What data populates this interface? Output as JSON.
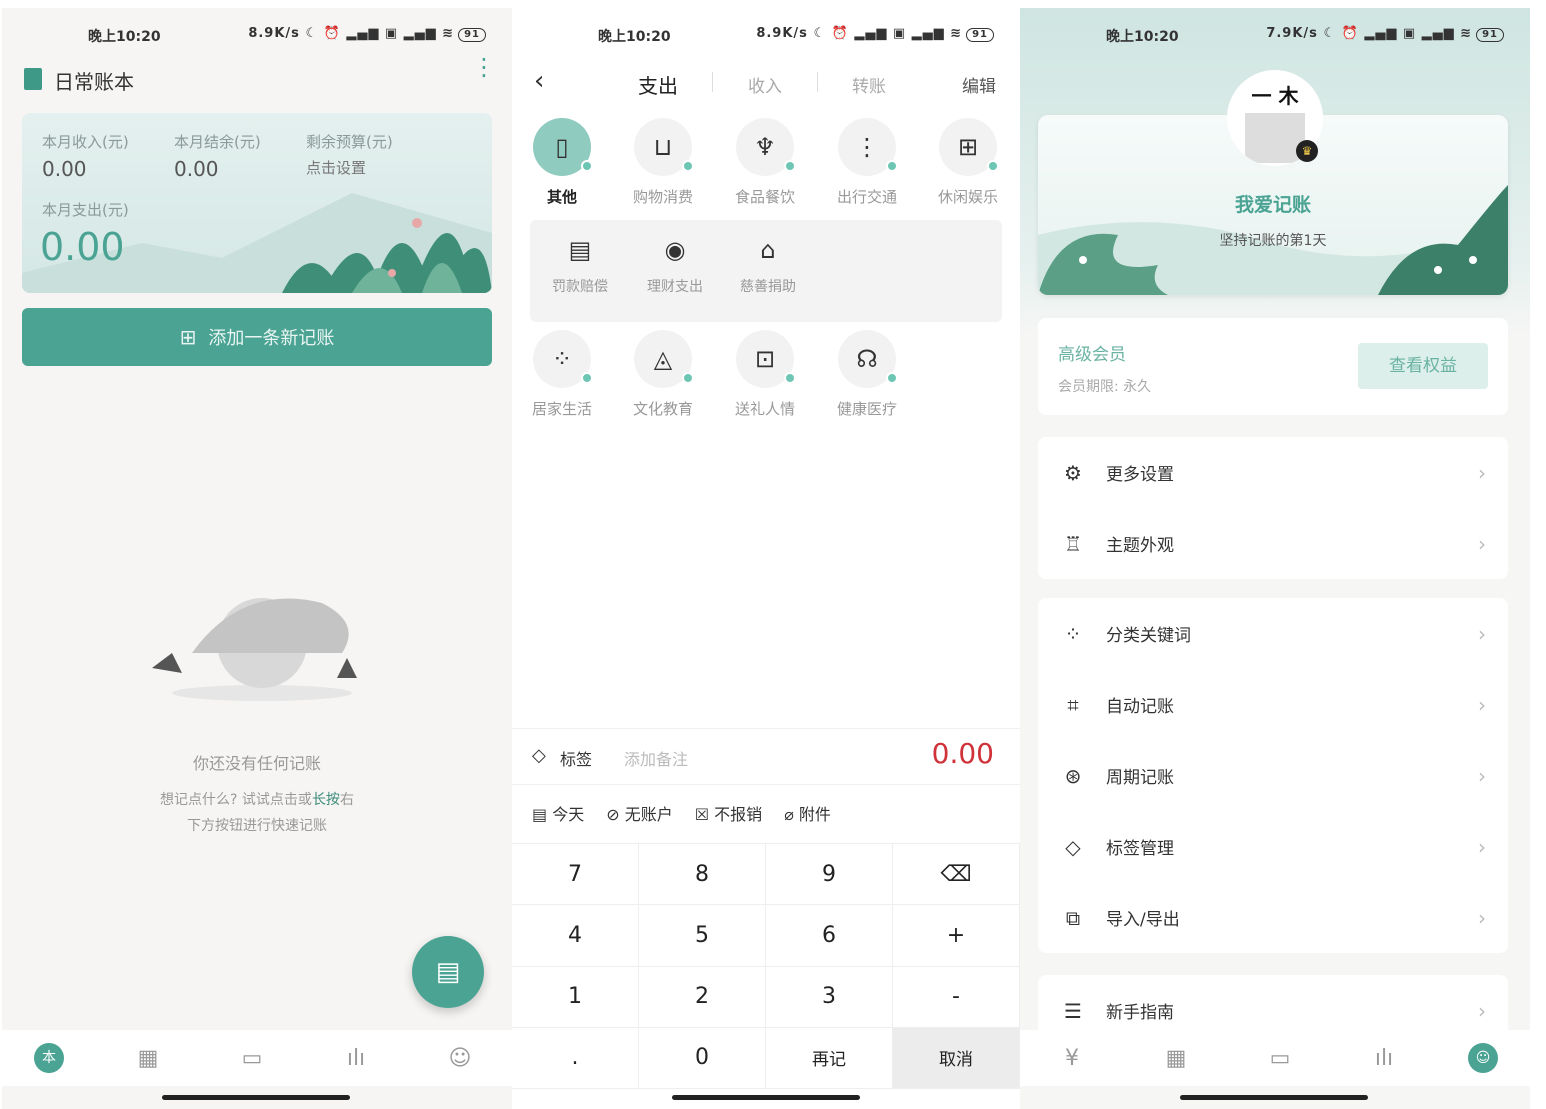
{
  "accent": "#4aa393",
  "status_bars": [
    {
      "time": "晚上10:20",
      "right": "8.9K/s ☾ ⏰ ▂▄▆ ▣ ▂▄▆ ≋",
      "battery": "91"
    },
    {
      "time": "晚上10:20",
      "right": "8.9K/s ☾ ⏰ ▂▄▆ ▣ ▂▄▆ ≋",
      "battery": "91"
    },
    {
      "time": "晚上10:20",
      "right": "7.9K/s ☾ ⏰ ▂▄▆ ▣ ▂▄▆ ≋",
      "battery": "91"
    }
  ],
  "home": {
    "book_title": "日常账本",
    "income_label": "本月收入(元)",
    "income_value": "0.00",
    "balance_label": "本月结余(元)",
    "balance_value": "0.00",
    "budget_label": "剩余预算(元)",
    "budget_value": "点击设置",
    "expense_label": "本月支出(元)",
    "expense_value": "0.00",
    "add_button": "添加一条新记账",
    "empty_title": "你还没有任何记账",
    "empty_hint_1": "想记点什么? 试试点击或",
    "empty_hint_bold": "长按",
    "empty_hint_2": "右",
    "empty_hint_3": "下方按钮进行快速记账"
  },
  "entry": {
    "tabs": [
      "支出",
      "收入",
      "转账"
    ],
    "edit": "编辑",
    "categories_row1": [
      {
        "label": "其他",
        "icon": "book-icon",
        "selected": true
      },
      {
        "label": "购物消费",
        "icon": "shopping-bag-icon"
      },
      {
        "label": "食品餐饮",
        "icon": "utensils-icon"
      },
      {
        "label": "出行交通",
        "icon": "traffic-light-icon"
      },
      {
        "label": "休闲娱乐",
        "icon": "gamepad-icon"
      }
    ],
    "subcategories": [
      {
        "label": "罚款赔偿",
        "icon": "receipt-icon"
      },
      {
        "label": "理财支出",
        "icon": "coin-icon"
      },
      {
        "label": "慈善捐助",
        "icon": "donation-box-icon"
      }
    ],
    "categories_row3": [
      {
        "label": "居家生活",
        "icon": "grid-icon"
      },
      {
        "label": "文化教育",
        "icon": "graduation-cap-icon"
      },
      {
        "label": "送礼人情",
        "icon": "gift-icon"
      },
      {
        "label": "健康医疗",
        "icon": "stethoscope-icon"
      }
    ],
    "tag_label": "标签",
    "note_placeholder": "添加备注",
    "amount": "0.00",
    "amount_color": "#d0323a",
    "options": [
      "今天",
      "无账户",
      "不报销",
      "附件"
    ],
    "keys": [
      "7",
      "8",
      "9",
      "⌫",
      "4",
      "5",
      "6",
      "+",
      "1",
      "2",
      "3",
      "-",
      ".",
      "0",
      "再记",
      "取消"
    ]
  },
  "profile": {
    "avatar_text": "一 木",
    "nickname": "我爱记账",
    "streak": "坚持记账的第1天",
    "member_title": "高级会员",
    "member_expiry": "会员期限: 永久",
    "benefits_button": "查看权益",
    "group1": [
      "更多设置",
      "主题外观"
    ],
    "group2": [
      "分类关键词",
      "自动记账",
      "周期记账",
      "标签管理",
      "导入/导出"
    ],
    "group3": [
      "新手指南"
    ]
  }
}
